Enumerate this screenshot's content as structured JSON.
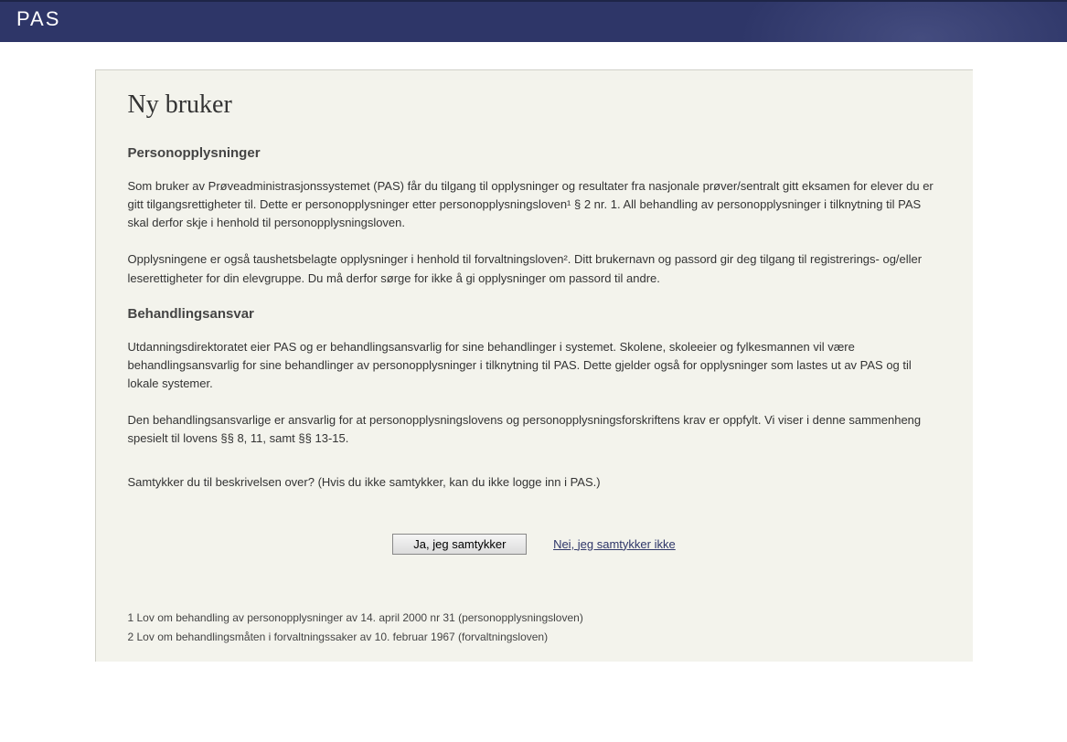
{
  "header": {
    "title": "PAS"
  },
  "page": {
    "title": "Ny bruker",
    "section1_heading": "Personopplysninger",
    "section1_para1": "Som bruker av Prøveadministrasjonssystemet (PAS) får du tilgang til opplysninger og resultater fra nasjonale prøver/sentralt gitt eksamen for elever du er gitt tilgangsrettigheter til. Dette er personopplysninger etter personopplysningsloven¹ § 2 nr. 1. All behandling av personopplysninger i tilknytning til PAS skal derfor skje i henhold til personopplysningsloven.",
    "section1_para2": "Opplysningene er også taushetsbelagte opplysninger i henhold til forvaltningsloven². Ditt brukernavn og passord gir deg tilgang til registrerings- og/eller leserettigheter for din elevgruppe. Du må derfor sørge for ikke å gi opplysninger om passord til andre.",
    "section2_heading": "Behandlingsansvar",
    "section2_para1": "Utdanningsdirektoratet eier PAS og er behandlingsansvarlig for sine behandlinger i systemet. Skolene, skoleeier og fylkesmannen vil være behandlingsansvarlig for sine behandlinger av personopplysninger i tilknytning til PAS. Dette gjelder også for opplysninger som lastes ut av PAS og til lokale systemer.",
    "section2_para2": "Den behandlingsansvarlige er ansvarlig for at personopplysningslovens og personopplysningsforskriftens krav er oppfylt. Vi viser i denne sammenheng spesielt til lovens §§ 8, 11, samt §§ 13-15.",
    "consent_question": "Samtykker du til beskrivelsen over? (Hvis du ikke samtykker, kan du ikke logge inn i PAS.)",
    "consent_button": "Ja, jeg samtykker",
    "decline_link": "Nei, jeg samtykker ikke",
    "footnote1": "1 Lov om behandling av personopplysninger av 14. april 2000 nr 31 (personopplysningsloven)",
    "footnote2": "2 Lov om behandlingsmåten i forvaltningssaker av 10. februar 1967 (forvaltningsloven)"
  }
}
